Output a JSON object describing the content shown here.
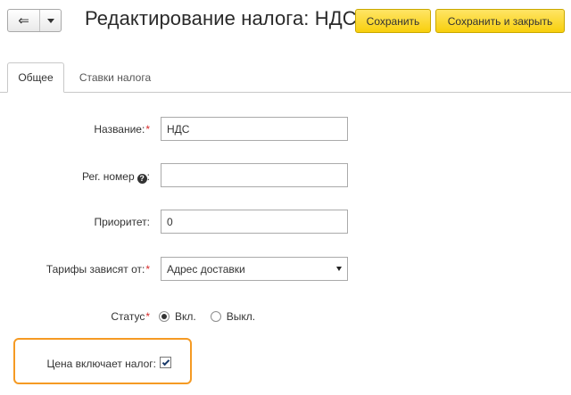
{
  "header": {
    "title": "Редактирование налога: НДС",
    "back_icon": "back-arrow-icon",
    "menu_icon": "chevron-down-icon",
    "save_label": "Сохранить",
    "save_close_label": "Сохранить и закрыть",
    "accent_color": "#f8cf0c"
  },
  "tabs": [
    {
      "label": "Общее",
      "active": true
    },
    {
      "label": "Ставки налога",
      "active": false
    }
  ],
  "form": {
    "name": {
      "label": "Название:",
      "required": true,
      "value": "НДС"
    },
    "reg_number": {
      "label": "Рег. номер",
      "suffix": ":",
      "help_icon": "?",
      "value": ""
    },
    "priority": {
      "label": "Приоритет:",
      "value": "0"
    },
    "tariffs": {
      "label": "Тарифы зависят от:",
      "required": true,
      "selected": "Адрес доставки"
    },
    "status": {
      "label": "Статус",
      "required": true,
      "options": [
        "Вкл.",
        "Выкл."
      ],
      "selected": "Вкл."
    },
    "price_includes_tax": {
      "label": "Цена включает налог:",
      "checked": true,
      "highlight_color": "#f59a23"
    }
  },
  "required_marker": "*"
}
